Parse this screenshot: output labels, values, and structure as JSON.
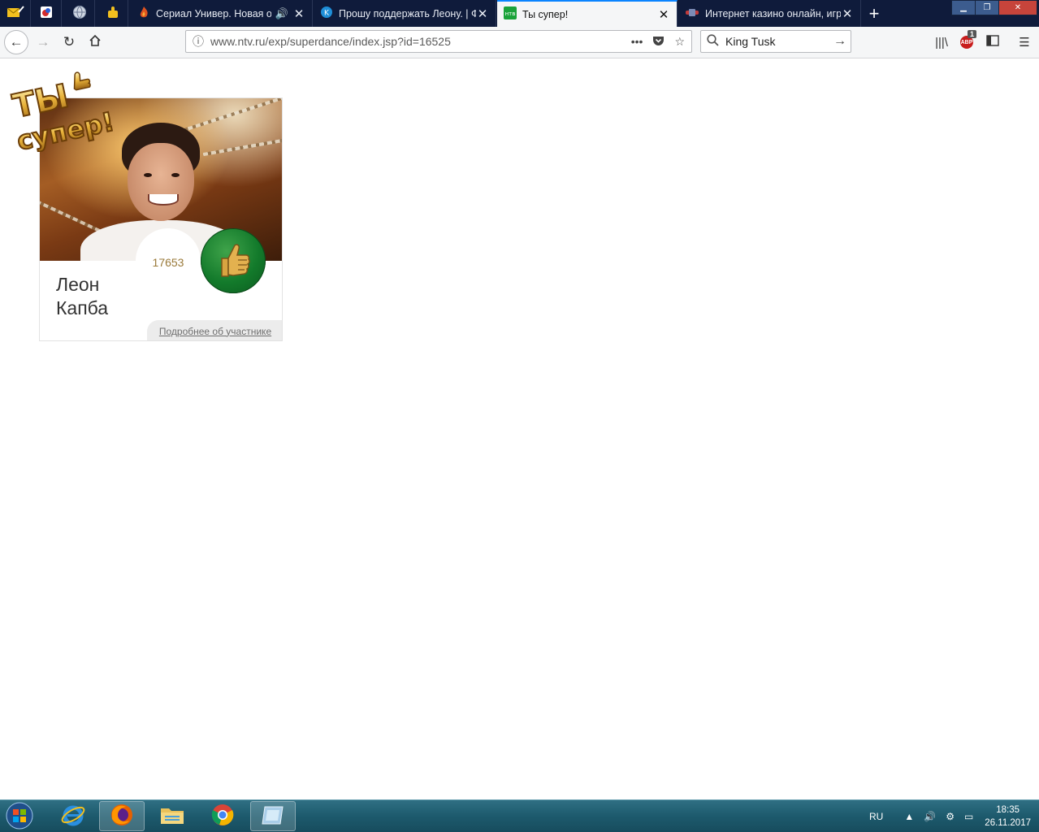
{
  "browser": {
    "tabs": [
      {
        "title": "Сериал Универ. Новая общ",
        "has_audio": true
      },
      {
        "title": "Прошу поддержать Леону. | Ф"
      },
      {
        "title": "Ты супер!",
        "active": true
      },
      {
        "title": "Интернет казино онлайн, игра"
      }
    ],
    "url": "www.ntv.ru/exp/superdance/index.jsp?id=16525",
    "search_value": "King Tusk",
    "adblock_badge": "1",
    "adblock_label": "ABP"
  },
  "card": {
    "votes": "17653",
    "first_name": "Леон",
    "last_name": "Капба",
    "details_link": "Подробнее об участнике"
  },
  "colors": {
    "tab_bar": "#0f1b3b",
    "active_tab_accent": "#0a84ff",
    "like_green": "#137a2b",
    "vote_gold": "#9a7a3a",
    "taskbar": "#1d5a6d"
  },
  "taskbar": {
    "lang": "RU",
    "time": "18:35",
    "date": "26.11.2017"
  }
}
